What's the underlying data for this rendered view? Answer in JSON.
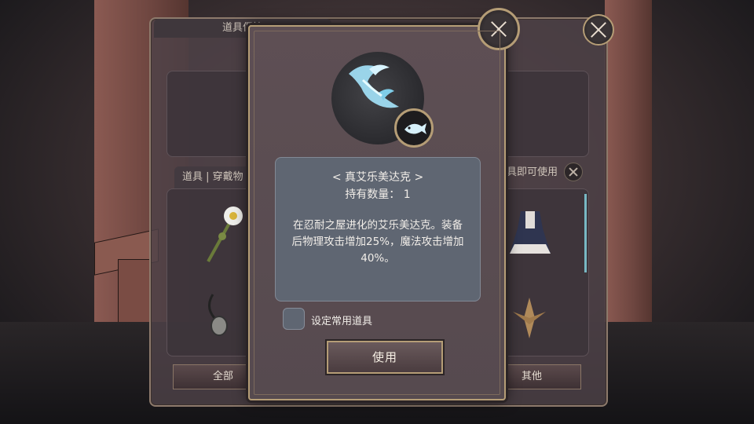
{
  "background_panel": {
    "header_title": "道具保管",
    "tab_left": "道具 | 穿戴物",
    "tab_right": "道具即可使用",
    "filter_all": "全部",
    "filter_other": "其他"
  },
  "item_popup": {
    "name": "< 真艾乐美达克 >",
    "quantity_label": "持有数量：",
    "quantity_value": "1",
    "description": "在忍耐之屋进化的艾乐美达克。装备后物理攻击增加25%，魔法攻击增加40%。",
    "set_favorite_label": "设定常用道具",
    "set_favorite_checked": false,
    "use_button_label": "使用"
  },
  "icons": {
    "close": "close-icon",
    "item": "crystal-scythe-icon",
    "badge": "fish-badge-icon"
  },
  "colors": {
    "gold_border": "#b59d76",
    "modal_bg": "#5e4f54",
    "desc_bg": "#5f6672",
    "text": "#f1ede8"
  }
}
